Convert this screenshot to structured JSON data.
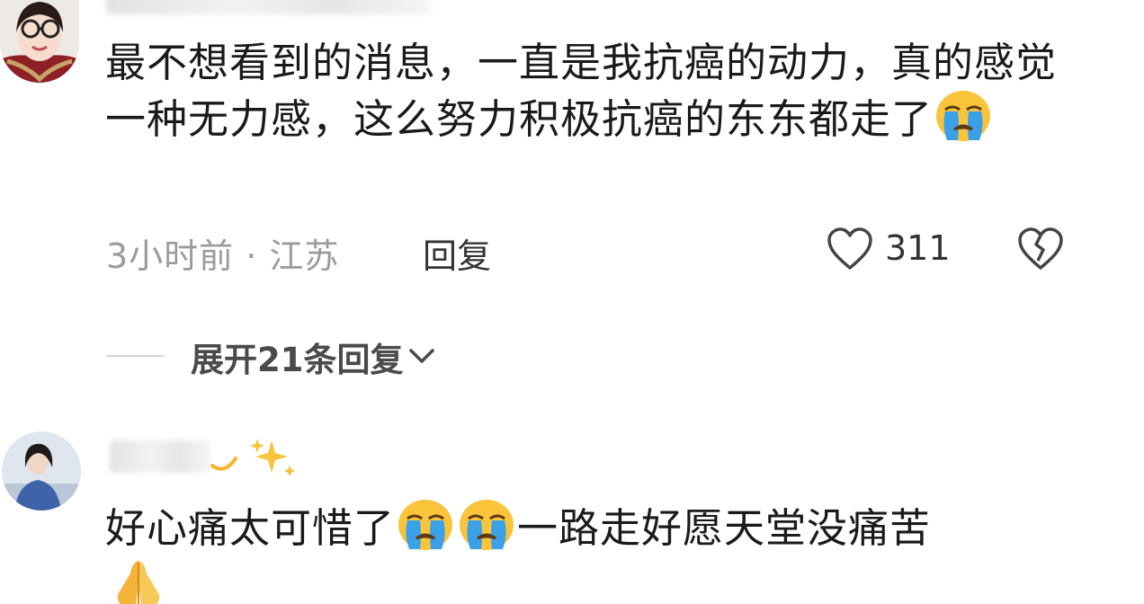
{
  "comments": [
    {
      "text": "最不想看到的消息，一直是我抗癌的动力，真的感觉一种无力感，这么努力积极抗癌的东东都走了",
      "emojis": [
        "loudly-crying-face"
      ],
      "meta": {
        "time_location": "3小时前 · 江苏",
        "reply_label": "回复",
        "like_count": "311"
      }
    },
    {
      "text_part1": "好心痛太可惜了",
      "text_part2": "一路走好愿天堂没痛苦",
      "emojis": [
        "loudly-crying-face",
        "loudly-crying-face",
        "folded-hands"
      ],
      "name_emojis": [
        "sparkles"
      ]
    }
  ],
  "expand": {
    "label": "展开21条回复"
  },
  "icons": {
    "like": "heart-outline-icon",
    "dislike": "broken-heart-icon",
    "expand": "chevron-down-icon"
  },
  "colors": {
    "text": "#1a1a1a",
    "meta": "#9b9b9b",
    "action": "#333333",
    "emoji_face": "#f9c43a",
    "emoji_tear": "#3aa0e8"
  }
}
